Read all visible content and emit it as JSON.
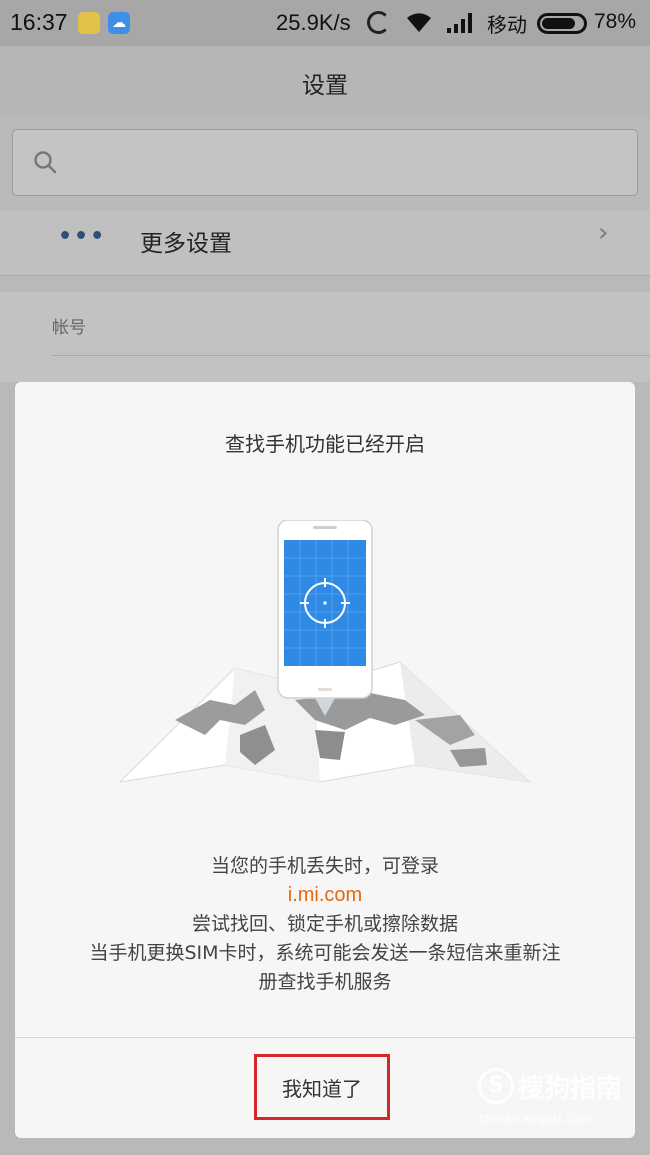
{
  "status_bar": {
    "time": "16:37",
    "net_speed": "25.9K/s",
    "carrier": "移动",
    "battery_percent": "78%",
    "battery_level": 0.78,
    "notification_icons": [
      "app-notification-icon",
      "cloud-icon"
    ],
    "indicator_icons": [
      "sync-icon",
      "wifi-icon",
      "signal-icon",
      "battery-icon"
    ]
  },
  "settings_page": {
    "title": "设置",
    "search_placeholder": "",
    "more_settings_label": "更多设置",
    "account_section_label": "帐号"
  },
  "dialog": {
    "title": "查找手机功能已经开启",
    "line1": "当您的手机丢失时，可登录",
    "link": "i.mi.com",
    "line2": "尝试找回、锁定手机或擦除数据",
    "line3": "当手机更换SIM卡时，系统可能会发送一条短信来重新注",
    "line4": "册查找手机服务",
    "confirm_label": "我知道了",
    "illustration_icons": [
      "phone-icon",
      "map-icon",
      "target-icon"
    ]
  },
  "watermark": {
    "brand": "搜狗指南",
    "url": "zhinan.sogou.com"
  },
  "colors": {
    "link_orange": "#e8680a",
    "phone_screen_blue": "#2f8ae6",
    "highlight_red": "#d6262c"
  }
}
